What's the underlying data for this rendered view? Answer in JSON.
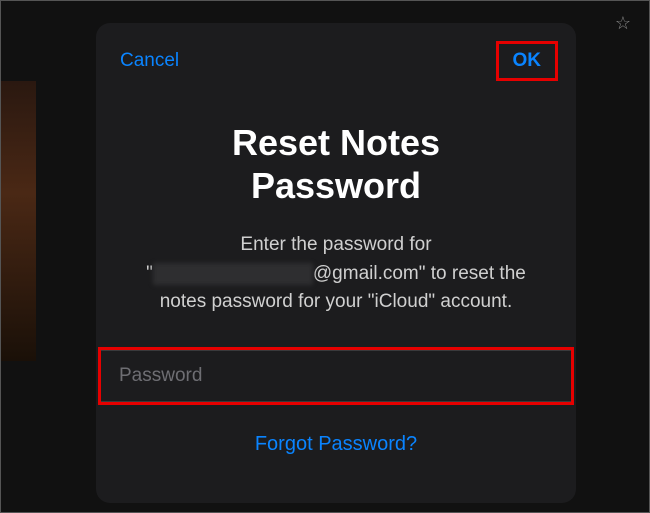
{
  "header": {
    "cancel_label": "Cancel",
    "ok_label": "OK"
  },
  "dialog": {
    "title_line1": "Reset Notes",
    "title_line2": "Password",
    "description_prefix": "Enter the password for",
    "email_visible_part": "@gmail.com\"",
    "description_suffix": "to reset the notes password for your \"iCloud\" account."
  },
  "input": {
    "placeholder": "Password",
    "value": ""
  },
  "links": {
    "forgot_label": "Forgot Password?"
  }
}
